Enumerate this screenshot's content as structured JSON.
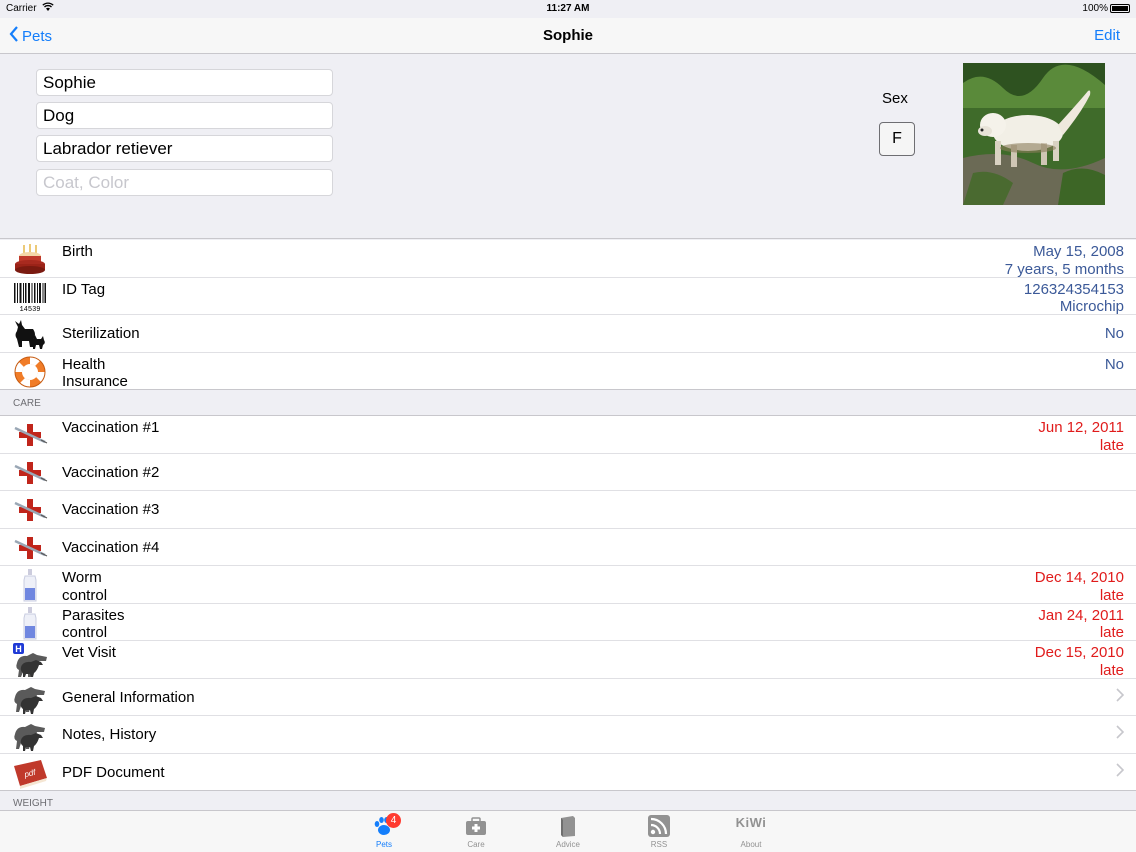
{
  "status_bar": {
    "carrier": "Carrier",
    "time": "11:27 AM",
    "battery": "100%"
  },
  "nav": {
    "back_label": "Pets",
    "title": "Sophie",
    "edit_label": "Edit"
  },
  "header": {
    "name": "Sophie",
    "species": "Dog",
    "breed": "Labrador retiever",
    "coat_placeholder": "Coat, Color",
    "sex_label": "Sex",
    "sex_value": "F"
  },
  "info_rows": [
    {
      "icon": "birthday-cake-icon",
      "label": "Birth",
      "value1": "May 15, 2008",
      "value2": "7 years, 5 months"
    },
    {
      "icon": "barcode-icon",
      "label": "ID Tag",
      "value1": "126324354153",
      "value2": "Microchip",
      "barcode_digits": "14539"
    },
    {
      "icon": "cat-dog-silhouette-icon",
      "label": "Sterilization",
      "value1": "No"
    },
    {
      "icon": "life-ring-icon",
      "label1": "Health",
      "label2": "Insurance",
      "value1": "No"
    }
  ],
  "care_section": {
    "title": "CARE"
  },
  "care_rows": [
    {
      "icon": "syringe-icon",
      "label": "Vaccination #1",
      "value1": "Jun 12, 2011",
      "value2": "late"
    },
    {
      "icon": "syringe-icon",
      "label": "Vaccination #2"
    },
    {
      "icon": "syringe-icon",
      "label": "Vaccination #3"
    },
    {
      "icon": "syringe-icon",
      "label": "Vaccination #4"
    },
    {
      "icon": "medicine-bottle-icon",
      "label1": "Worm",
      "label2": "control",
      "value1": "Dec 14, 2010",
      "value2": "late"
    },
    {
      "icon": "medicine-bottle-icon",
      "label1": "Parasites",
      "label2": "control",
      "value1": "Jan 24, 2011",
      "value2": "late"
    },
    {
      "icon": "vet-hospital-icon",
      "label": "Vet Visit",
      "value1": "Dec 15, 2010",
      "value2": "late",
      "hospital_mark": "H"
    },
    {
      "icon": "dogs-icon",
      "label": "General Information"
    },
    {
      "icon": "dogs-icon",
      "label": "Notes, History"
    },
    {
      "icon": "pdf-book-icon",
      "label": "PDF Document",
      "pdf_mark": "pdf"
    }
  ],
  "weight_section": {
    "title": "WEIGHT"
  },
  "tabs": [
    {
      "label": "Pets",
      "icon": "paw-icon",
      "badge": "4",
      "active": true
    },
    {
      "label": "Care",
      "icon": "first-aid-kit-icon"
    },
    {
      "label": "Advice",
      "icon": "book-icon"
    },
    {
      "label": "RSS",
      "icon": "rss-icon"
    },
    {
      "label": "About",
      "icon": "kiwi-text-icon",
      "text": "KiWi"
    }
  ],
  "colors": {
    "accent": "#147efb",
    "value_blue": "#3b5998",
    "late_red": "#e01b1b",
    "badge_red": "#ff3b30"
  }
}
